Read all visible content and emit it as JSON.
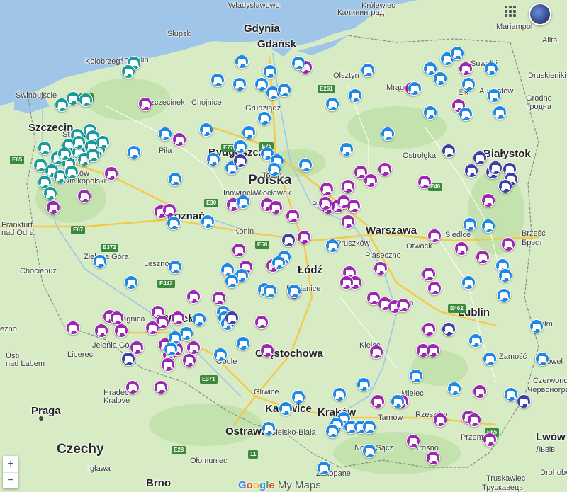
{
  "map": {
    "brand": {
      "logo_text": "Google",
      "product": "My Maps"
    },
    "controls": {
      "zoom_in": "+",
      "zoom_out": "−"
    },
    "colors": {
      "teal": "#1a9b9b",
      "blue": "#1e88e5",
      "purple": "#9c27b0",
      "indigo": "#3f3fa8",
      "water": "#9fc5e8",
      "land": "#d7ecc4",
      "road": "#f2c94c"
    },
    "marker_icon": "tractor-icon",
    "labels": {
      "wladyslawowo": "Władysławowo",
      "krolewiec_ru": "Калининград",
      "krolewiec": "Królewiec",
      "gdynia": "Gdynia",
      "gdansk": "Gdańsk",
      "slupsk": "Słupsk",
      "koszalin": "Koszalin",
      "kolobrzeg": "Kołobrzeg",
      "swinoujscie": "Świnoujście",
      "szczecin": "Szczecin",
      "stargard": "Stargard",
      "gorzow": "Gorzów\nWielkopolski",
      "frankfurt": "Frankfurt\nnad Odrą",
      "zielona": "Zielona Góra",
      "chociebuz": "Chociebuz",
      "leszno": "Leszno",
      "legnica": "Legnica",
      "wroclaw": "Wrocław",
      "jelenia": "Jelenia Góra",
      "liberec": "Liberec",
      "usti": "Ústí\nnad Labem",
      "hradec": "Hradec\nKralove",
      "praga": "Praga",
      "czechy": "Czechy",
      "pila": "Piła",
      "poznan": "Poznań",
      "konin": "Konin",
      "bydgoszcz": "Bydgoszcz",
      "inowroclaw": "Inowrocław",
      "wloclawek": "Włocławek",
      "polska": "Polska",
      "torun": "Toruń",
      "grudziadz": "Grudziądz",
      "chojnice": "Chojnice",
      "szczecinek": "Szczecinek",
      "olsztyn": "Olsztyn",
      "elk": "Ełk",
      "mragowo": "Mrągowo",
      "augustow": "Augustów",
      "suwalki": "Suwałki",
      "mariampol": "Mariampol",
      "alita": "Alita",
      "druskieniki": "Druskieniki",
      "grodno": "Grodno",
      "grodno_by": "Гродна",
      "bialystok": "Białystok",
      "ostroleka": "Ostrołęka",
      "plock": "Płock",
      "warszawa": "Warszawa",
      "pruszkow": "Pruszków",
      "piaseczno": "Piaseczno",
      "otwock": "Otwock",
      "siedlce": "Siedlce",
      "brzesc": "Brześć",
      "brzesc_by": "Брэст",
      "lodz": "Łódź",
      "pabianice": "Pabianice",
      "radom": "Radom",
      "lublin": "Lublin",
      "chelm": "Chełm",
      "zamosc": "Zamość",
      "kielce": "Kielce",
      "opole": "Opole",
      "gliwice": "Gliwice",
      "katowice": "Katowice",
      "ostrawa": "Ostrawa",
      "bielsko": "Bielsko-Biała",
      "krakow": "Kraków",
      "tarnow": "Tarnów",
      "mielec": "Mielec",
      "rzeszow": "Rzeszów",
      "przemysl": "Przemyśl",
      "krosno": "Krosno",
      "nowy_sacz": "Nowy Sącz",
      "zakopane": "Zakopane",
      "olomuniec": "Ołomuniec",
      "brno": "Brno",
      "iglawa": "Igława",
      "lwow": "Lwów",
      "lwow_ua": "Львів",
      "czerwonograd": "Czerwonograd",
      "czerwonograd_ua": "Червоноград",
      "kowel": "Kowel",
      "truskawiec": "Truskawiec",
      "truskawiec_ua": "Трускавець",
      "drohobycz": "Drohobycz",
      "chochowa": "Częstochowa",
      "ezno": "ezno"
    },
    "roads": [
      "E28",
      "E65",
      "E77",
      "E75",
      "E261",
      "E30",
      "E67",
      "E372",
      "E40",
      "E462",
      "E442",
      "E50",
      "E371",
      "11"
    ],
    "marker_count": {
      "teal": 26,
      "blue": 88,
      "purple": 82,
      "indigo": 14
    }
  }
}
